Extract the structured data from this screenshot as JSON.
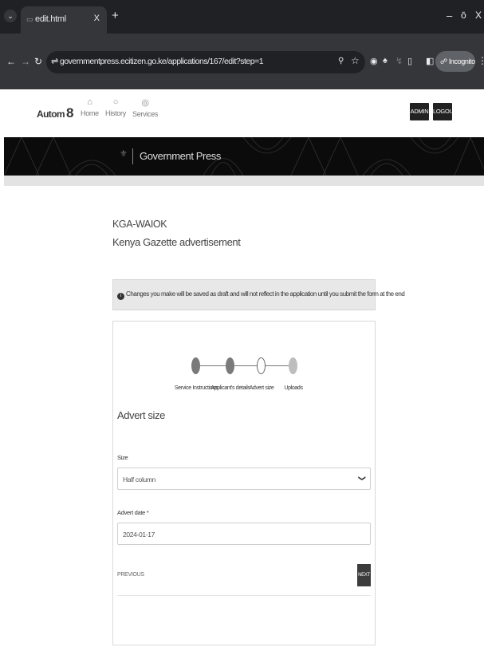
{
  "browser": {
    "tab_title": "edit.html",
    "url": "governmentpress.ecitizen.go.ke/applications/167/edit?step=1",
    "incognito_label": "Incognito",
    "new_tab": "+",
    "tab_close": "X",
    "window_buttons": {
      "minimize": "–",
      "maximize": "ō",
      "close": "X"
    }
  },
  "site": {
    "logo_text": "Autom",
    "logo_mark": "8",
    "nav": [
      {
        "label": "Home",
        "icon": "home-icon",
        "glyph": "⌂"
      },
      {
        "label": "History",
        "icon": "history-icon",
        "glyph": "○"
      },
      {
        "label": "Services",
        "icon": "services-icon",
        "glyph": "◎"
      }
    ],
    "admin_button": "ADMIN",
    "logout_button": "LOGOUT",
    "banner_title": "Government Press"
  },
  "application": {
    "code": "KGA-WAIOK",
    "service_title": "Kenya Gazette advertisement",
    "alert_text": "Changes you make will be saved as draft and will not reflect in the application until you submit the form at the end"
  },
  "steps": [
    {
      "label": "Service Instructions",
      "state": "done"
    },
    {
      "label": "Applicant's details",
      "state": "done"
    },
    {
      "label": "Advert size",
      "state": "current"
    },
    {
      "label": "Uploads",
      "state": "todo"
    }
  ],
  "form": {
    "section_title": "Advert size",
    "size_label": "Size",
    "size_value": "Half column",
    "date_label": "Advert date *",
    "date_value": "2024-01-17",
    "previous_label": "PREVIOUS",
    "next_label": "NEXT"
  },
  "colors": {
    "chrome_dark": "#202124",
    "chrome_toolbar": "#35363a",
    "banner": "#0b0b0b",
    "button_dark": "#222222",
    "alert_bg": "#e8e8e8"
  }
}
